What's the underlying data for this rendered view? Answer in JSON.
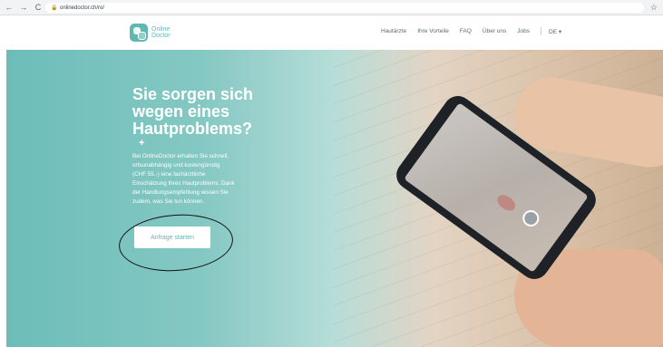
{
  "browser": {
    "back": "←",
    "forward": "→",
    "reload": "C",
    "lock": "🔒",
    "url": "onlinedoctor.ch/ro/",
    "star": "☆"
  },
  "header": {
    "logo_line1": "Online",
    "logo_line2": "Doctor",
    "nav": [
      "Hautärzte",
      "Ihre Vorteile",
      "FAQ",
      "Über uns",
      "Jobs",
      "DE ▾"
    ]
  },
  "hero": {
    "title_line1": "Sie sorgen sich",
    "title_line2": "wegen eines",
    "title_line3": "Hautproblems?",
    "plus": "+",
    "body_lines": [
      "Bei OnlineDoctor erhalten Sie schnell,",
      "ortsunabhängig und kostengünstig",
      "(CHF 55.-) eine fachärztliche",
      "Einschätzung Ihres Hautproblems. Dank",
      "der Handlungsempfehlung wissen Sie",
      "zudem, was Sie tun können."
    ],
    "cta": "Anfrage starten"
  }
}
